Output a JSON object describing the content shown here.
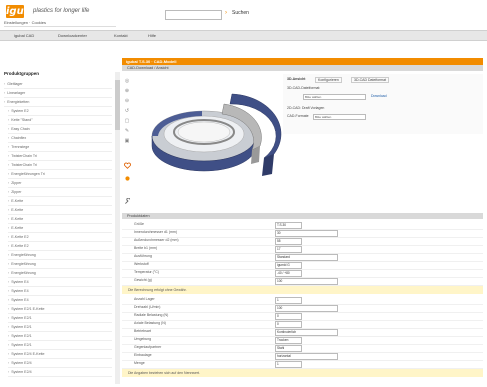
{
  "header": {
    "logo_text": "igus",
    "slogan": "plastics for longer life",
    "search_go": "›",
    "search_button": "Suchen"
  },
  "nav": {
    "items": [
      "igubal CAD",
      "Downloadcenter",
      "Kontakt",
      "Hilfe"
    ]
  },
  "sidebar": {
    "top_link": "Einstellungen · Cookies",
    "title": "Produktgruppen",
    "items": [
      {
        "label": "Gleitlager",
        "sub": false
      },
      {
        "label": "Linearlager",
        "sub": false
      },
      {
        "label": "Energieketten",
        "sub": false
      },
      {
        "label": "System E2",
        "sub": true
      },
      {
        "label": "Kette \"Stand\"",
        "sub": true
      },
      {
        "label": "Easy Chain",
        "sub": true
      },
      {
        "label": "Chainflex",
        "sub": true
      },
      {
        "label": "Trennstege",
        "sub": true
      },
      {
        "label": "TwisterChain Tri",
        "sub": true
      },
      {
        "label": "TwisterChain Tri",
        "sub": true
      },
      {
        "label": "Energieführungen Tri",
        "sub": true
      },
      {
        "label": "Zipper",
        "sub": true
      },
      {
        "label": "Zipper",
        "sub": true
      },
      {
        "label": "E-Kette",
        "sub": true
      },
      {
        "label": "E-Kette",
        "sub": true
      },
      {
        "label": "E-Kette",
        "sub": true
      },
      {
        "label": "E-Kette",
        "sub": true
      },
      {
        "label": "E-Kette E2",
        "sub": true
      },
      {
        "label": "E-Kette E2",
        "sub": true
      },
      {
        "label": "Energieführung",
        "sub": true
      },
      {
        "label": "Energieführung",
        "sub": true
      },
      {
        "label": "Energieführung",
        "sub": true
      },
      {
        "label": "System E4",
        "sub": true
      },
      {
        "label": "System E4",
        "sub": true
      },
      {
        "label": "System E4",
        "sub": true
      },
      {
        "label": "System E2/1 E-Kette",
        "sub": true
      },
      {
        "label": "System E2/1",
        "sub": true
      },
      {
        "label": "System E2/1",
        "sub": true
      },
      {
        "label": "System E2/1",
        "sub": true
      },
      {
        "label": "System E2/1",
        "sub": true
      },
      {
        "label": "System E2/4 E-Kette",
        "sub": true
      },
      {
        "label": "System E2/4",
        "sub": true
      },
      {
        "label": "System E2/4",
        "sub": true
      }
    ]
  },
  "main": {
    "title": "igubal T.S.30 · CAD-Modell",
    "section1": "CAD-Download / Ansicht",
    "right_panel": {
      "line1": "3D-Ansicht",
      "tab1": "Konfigurieren",
      "tab2": "3D-CAD Dateiformat",
      "format_label": "3D-CAD-Dateiformat:",
      "format_value": "Bitte wählen",
      "download": "Download",
      "line2": "2D-CAD: Draft Vorlagen",
      "line3": "CAD-Formate",
      "line3_value": "Bitte wählen"
    },
    "tools": [
      "◎",
      "⊕",
      "⊖",
      "↺",
      "▢",
      "✎",
      "▣"
    ],
    "section2": "Produktdaten",
    "params": [
      {
        "label": "Größe",
        "value": "T.S.30"
      },
      {
        "label": "Innendurchmesser d1 (mm)",
        "value": "30"
      },
      {
        "label": "Außendurchmesser d2 (mm)",
        "value": "55"
      },
      {
        "label": "Breite b1 (mm)",
        "value": "17"
      },
      {
        "label": "Ausführung",
        "value": "Standard"
      },
      {
        "label": "Werkstoff",
        "value": "igumid G"
      },
      {
        "label": "Temperatur (°C)",
        "value": "-40 / +80"
      },
      {
        "label": "Gewicht (g)",
        "value": "100"
      }
    ],
    "note1": "Die Berechnung erfolgt ohne Gewähr.",
    "params2": [
      {
        "label": "Anzahl Lager",
        "value": "1"
      },
      {
        "label": "Drehzahl (U/min)",
        "value": "100"
      },
      {
        "label": "Radiale Belastung (N)",
        "value": "0"
      },
      {
        "label": "Axiale Belastung (N)",
        "value": "0"
      },
      {
        "label": "Betriebsart",
        "value": "Kontinuierlich"
      },
      {
        "label": "Umgebung",
        "value": "Trocken"
      },
      {
        "label": "Gegenlaufpartner",
        "value": "Stahl"
      },
      {
        "label": "Einbaulage",
        "value": "horizontal"
      },
      {
        "label": "Menge",
        "value": "1"
      }
    ],
    "note2": "Die Angaben beziehen sich auf den Nennwert."
  }
}
